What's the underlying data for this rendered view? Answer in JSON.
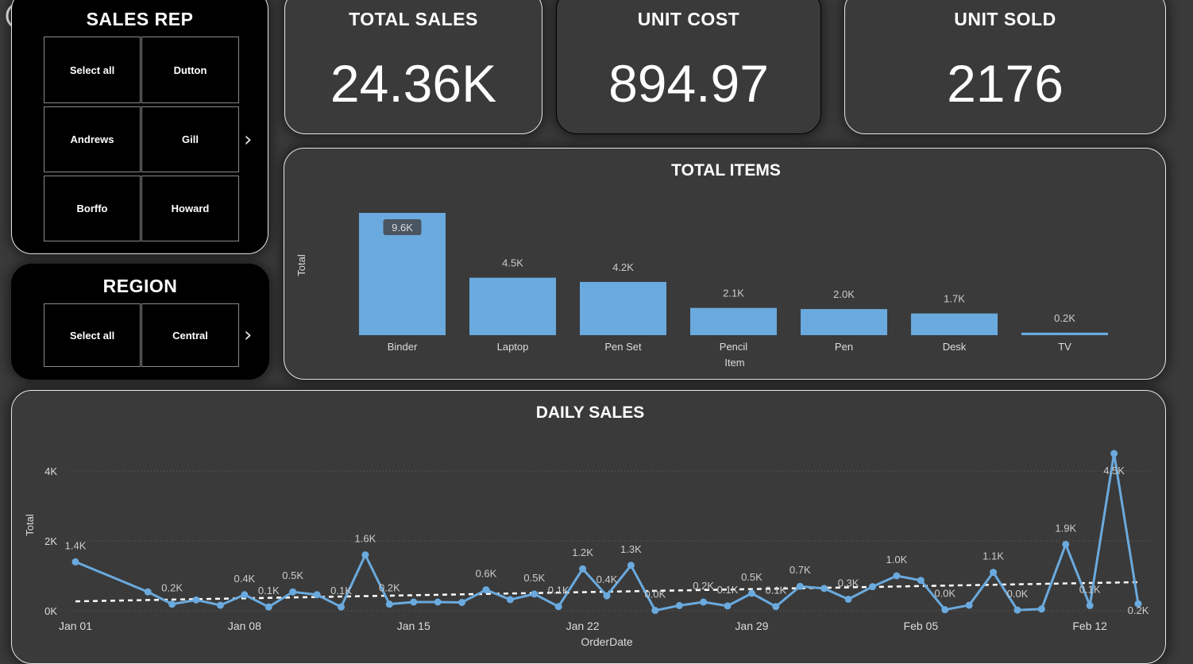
{
  "back_icon": "back-arrow-icon",
  "sales_rep": {
    "title": "SALES REP",
    "options": [
      "Select all",
      "Dutton",
      "Andrews",
      "Gill",
      "Borffo",
      "Howard"
    ],
    "next_icon": "chevron-right-icon"
  },
  "region": {
    "title": "REGION",
    "options": [
      "Select all",
      "Central"
    ],
    "next_icon": "chevron-right-icon"
  },
  "kpis": {
    "total_sales": {
      "label": "TOTAL SALES",
      "value": "24.36K"
    },
    "unit_cost": {
      "label": "UNIT COST",
      "value": "894.97"
    },
    "unit_sold": {
      "label": "UNIT SOLD",
      "value": "2176"
    }
  },
  "colors": {
    "bar": "#6aaade",
    "line": "#6aaade",
    "trend": "#ffffff",
    "background": "#3a3a3a"
  },
  "chart_data": [
    {
      "type": "bar",
      "title": "TOTAL ITEMS",
      "xlabel": "Item",
      "ylabel": "Total",
      "categories": [
        "Binder",
        "Laptop",
        "Pen Set",
        "Pencil",
        "Pen",
        "Desk",
        "TV"
      ],
      "values": [
        9577.65,
        4500,
        4169.87,
        2135.14,
        2045.22,
        1700,
        200
      ],
      "labels": [
        "9.6K",
        "4.5K",
        "4.2K",
        "2.1K",
        "2.0K",
        "1.7K",
        "0.2K"
      ]
    },
    {
      "type": "line",
      "title": "DAILY SALES",
      "xlabel": "OrderDate",
      "ylabel": "Total",
      "x_ticks": [
        "Jan 01",
        "Jan 08",
        "Jan 15",
        "Jan 22",
        "Jan 29",
        "Feb 05",
        "Feb 12"
      ],
      "y_ticks": [
        "0K",
        "2K",
        "4K"
      ],
      "ylim": [
        0,
        4000
      ],
      "grid": true,
      "trend_line": true,
      "x": [
        "Jan 01",
        "Jan 04",
        "Jan 05",
        "Jan 06",
        "Jan 07",
        "Jan 08",
        "Jan 09",
        "Jan 10",
        "Jan 11",
        "Jan 12",
        "Jan 13",
        "Jan 14",
        "Jan 15",
        "Jan 16",
        "Jan 17",
        "Jan 18",
        "Jan 19",
        "Jan 20",
        "Jan 21",
        "Jan 22",
        "Jan 23",
        "Jan 24",
        "Jan 25",
        "Jan 26",
        "Jan 27",
        "Jan 28",
        "Jan 29",
        "Jan 30",
        "Jan 31",
        "Feb 01",
        "Feb 02",
        "Feb 03",
        "Feb 04",
        "Feb 05",
        "Feb 06",
        "Feb 07",
        "Feb 08",
        "Feb 09",
        "Feb 10",
        "Feb 11",
        "Feb 12",
        "Feb 13",
        "Feb 14"
      ],
      "values": [
        1400,
        540,
        190,
        310,
        160,
        460,
        110,
        540,
        460,
        110,
        1600,
        190,
        250,
        250,
        240,
        600,
        320,
        480,
        120,
        1200,
        430,
        1300,
        10,
        150,
        250,
        140,
        500,
        120,
        700,
        640,
        330,
        690,
        1000,
        870,
        30,
        160,
        1100,
        20,
        50,
        1900,
        150,
        4500,
        200
      ],
      "labels": [
        "1.4K",
        "",
        "0.2K",
        "",
        "",
        "0.4K",
        "0.1K",
        "0.5K",
        "",
        "0.1K",
        "1.6K",
        "0.2K",
        "",
        "",
        "",
        "0.6K",
        "",
        "0.5K",
        "0.1K",
        "1.2K",
        "0.4K",
        "1.3K",
        "0.0K",
        "",
        "0.2K",
        "0.1K",
        "0.5K",
        "0.1K",
        "0.7K",
        "",
        "0.3K",
        "",
        "1.0K",
        "",
        "0.0K",
        "",
        "1.1K",
        "0.0K",
        "",
        "1.9K",
        "0.1K",
        "4.5K",
        "0.2K"
      ],
      "trend": [
        270,
        820
      ]
    }
  ]
}
